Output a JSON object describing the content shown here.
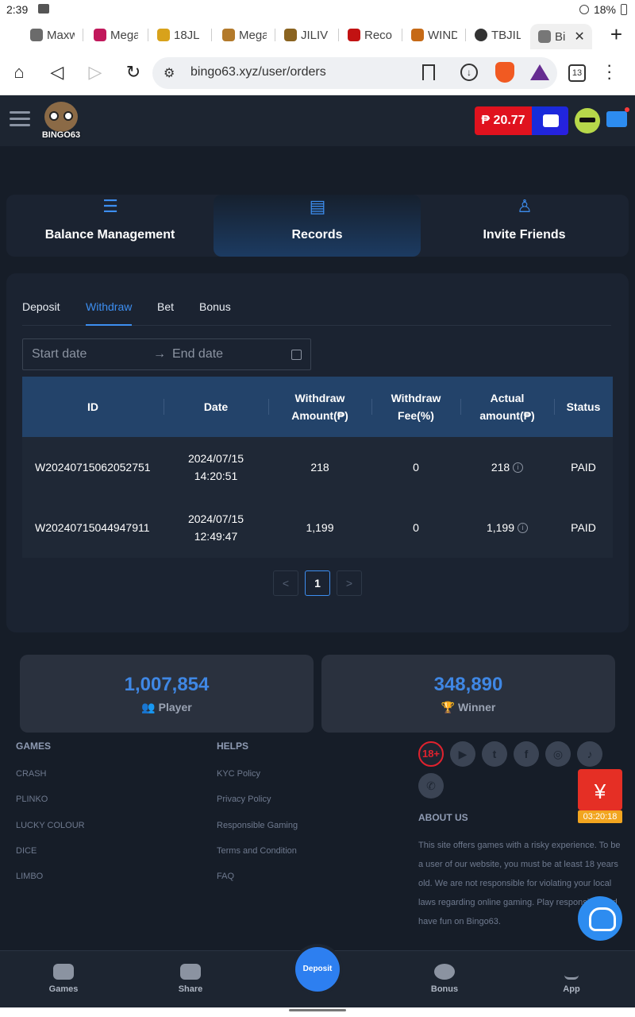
{
  "status_bar": {
    "time": "2:39",
    "battery": "18%"
  },
  "browser_tabs": [
    {
      "label": "Maxw",
      "color": "#6b6b6b"
    },
    {
      "label": "Mega",
      "color": "#c1185b"
    },
    {
      "label": "18JL",
      "color": "#d8a21b"
    },
    {
      "label": "Mega",
      "color": "#b37a2b"
    },
    {
      "label": "JILIV",
      "color": "#8a6320"
    },
    {
      "label": "Reco",
      "color": "#c21212"
    },
    {
      "label": "WIND",
      "color": "#c66a16"
    },
    {
      "label": "TBJIL",
      "color": "#333333"
    },
    {
      "label": "Bi",
      "color": "#777777"
    }
  ],
  "url": "bingo63.xyz/user/orders",
  "tab_count": "13",
  "header": {
    "logo_text": "BINGO63",
    "balance": "₱ 20.77"
  },
  "account_tabs": [
    {
      "label": "Balance Management",
      "icon": "list-icon"
    },
    {
      "label": "Records",
      "icon": "document-icon"
    },
    {
      "label": "Invite Friends",
      "icon": "add-user-icon"
    }
  ],
  "record_tabs": [
    "Deposit",
    "Withdraw",
    "Bet",
    "Bonus"
  ],
  "active_record_tab": "Withdraw",
  "date_range": {
    "start_placeholder": "Start date",
    "end_placeholder": "End date"
  },
  "table": {
    "columns": [
      "ID",
      "Date",
      "Withdraw\nAmount(₱)",
      "Withdraw\nFee(%)",
      "Actual\namount(₱)",
      "Status"
    ],
    "rows": [
      {
        "id": "W20240715062052751",
        "date": "2024/07/15\n14:20:51",
        "amount": "218",
        "fee": "0",
        "actual": "218",
        "status": "PAID"
      },
      {
        "id": "W20240715044947911",
        "date": "2024/07/15\n12:49:47",
        "amount": "1,199",
        "fee": "0",
        "actual": "1,199",
        "status": "PAID"
      }
    ]
  },
  "pagination": {
    "prev": "<",
    "current": "1",
    "next": ">"
  },
  "stats": [
    {
      "value": "1,007,854",
      "label": "Player"
    },
    {
      "value": "348,890",
      "label": "Winner"
    }
  ],
  "footer": {
    "games_title": "GAMES",
    "games": [
      "CRASH",
      "PLINKO",
      "LUCKY COLOUR",
      "DICE",
      "LIMBO"
    ],
    "helps_title": "HELPS",
    "helps": [
      "KYC Policy",
      "Privacy Policy",
      "Responsible Gaming",
      "Terms and Condition",
      "FAQ"
    ],
    "social": [
      "18+",
      "youtube-icon",
      "twitter-icon",
      "facebook-icon",
      "instagram-icon",
      "tiktok-icon",
      "whatsapp-icon"
    ],
    "about_title": "ABOUT US",
    "about_text": "This site offers games with a risky experience. To be a user of our website, you must be at least 18 years old. We are not responsible for violating your local laws regarding online gaming. Play responsibly and have fun on Bingo63."
  },
  "red_packet": {
    "symbol": "¥",
    "timer": "03:20:18"
  },
  "bottom_nav": [
    {
      "label": "Games",
      "icon": "gamepad-icon"
    },
    {
      "label": "Share",
      "icon": "share-icon"
    },
    {
      "label": "Deposit",
      "icon": ""
    },
    {
      "label": "Bonus",
      "icon": "gift-icon"
    },
    {
      "label": "App",
      "icon": "download-icon"
    }
  ]
}
